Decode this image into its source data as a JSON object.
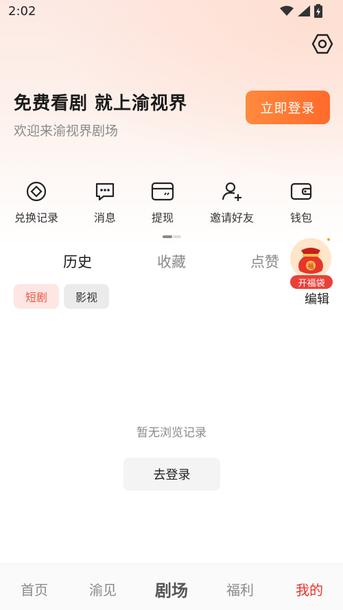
{
  "status_bar": {
    "time": "2:02"
  },
  "header": {
    "headline": "免费看剧 就上渝视界",
    "subline": "欢迎来渝视界剧场",
    "login_button": "立即登录"
  },
  "shortcuts": [
    {
      "label": "兑换记录",
      "icon": "exchange-icon"
    },
    {
      "label": "消息",
      "icon": "message-icon"
    },
    {
      "label": "提现",
      "icon": "withdraw-icon"
    },
    {
      "label": "邀请好友",
      "icon": "invite-icon"
    },
    {
      "label": "钱包",
      "icon": "wallet-icon"
    }
  ],
  "tabs": [
    {
      "label": "历史",
      "active": true
    },
    {
      "label": "收藏",
      "active": false
    },
    {
      "label": "点赞",
      "active": false
    }
  ],
  "filters": [
    {
      "label": "短剧",
      "active": true
    },
    {
      "label": "影视",
      "active": false
    }
  ],
  "edit_label": "编辑",
  "lucky_bag": {
    "label": "开福袋",
    "bag_text": "福"
  },
  "empty_state": {
    "message": "暂无浏览记录",
    "button": "去登录"
  },
  "bottom_nav": [
    {
      "label": "首页",
      "active": false
    },
    {
      "label": "渝见",
      "active": false
    },
    {
      "label": "剧场",
      "active": false
    },
    {
      "label": "福利",
      "active": false
    },
    {
      "label": "我的",
      "active": true
    }
  ],
  "colors": {
    "accent": "#ff6a2a",
    "active_red": "#e8352b",
    "chip_active_bg": "#fde6e3"
  }
}
